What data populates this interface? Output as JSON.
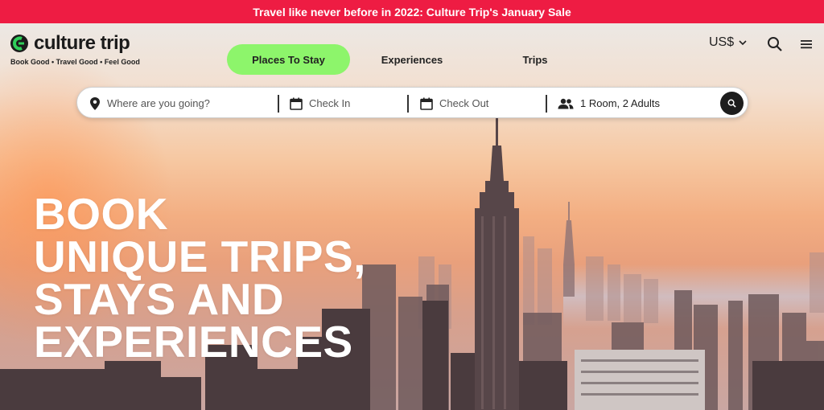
{
  "promo": {
    "text": "Travel like never before in 2022: Culture Trip's January Sale"
  },
  "header": {
    "logo_text": "culture trip",
    "tagline": "Book Good • Travel Good • Feel Good",
    "currency": "US$",
    "tabs": [
      {
        "label": "Places To Stay",
        "active": true
      },
      {
        "label": "Experiences",
        "active": false
      },
      {
        "label": "Trips",
        "active": false
      }
    ]
  },
  "search": {
    "destination_placeholder": "Where are you going?",
    "check_in_placeholder": "Check In",
    "check_out_placeholder": "Check Out",
    "guests_value": "1 Room, 2 Adults"
  },
  "hero": {
    "headline_lines": [
      "BOOK",
      "UNIQUE TRIPS,",
      "STAYS AND",
      "EXPERIENCES"
    ]
  },
  "colors": {
    "promo_bg": "#ee1c43",
    "active_tab": "#8df56b",
    "logo_green": "#2fcf5a"
  },
  "icons": {
    "logo": "culture-trip-logo-icon",
    "currency": "chevron-down-icon",
    "search": "search-icon",
    "menu": "hamburger-menu-icon",
    "destination": "location-pin-icon",
    "check_in": "calendar-icon",
    "check_out": "calendar-icon",
    "guests": "people-icon",
    "submit": "search-icon"
  }
}
